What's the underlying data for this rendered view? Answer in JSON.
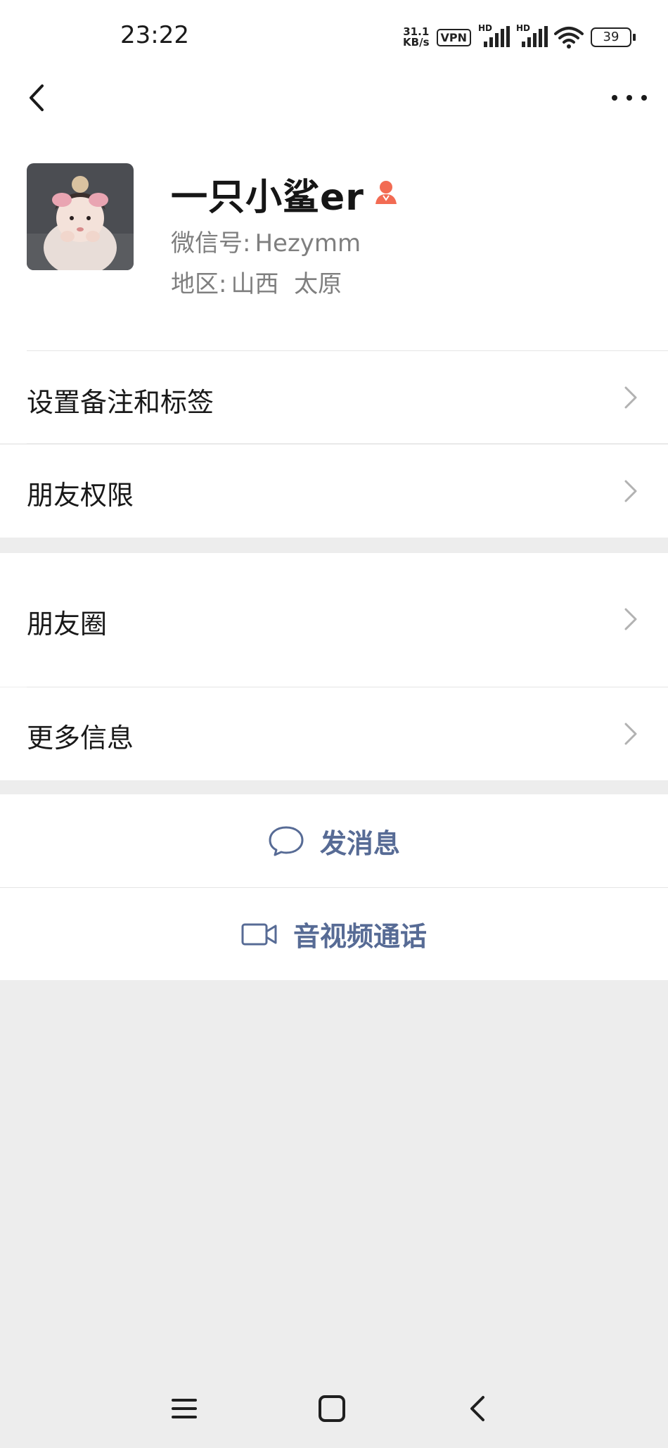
{
  "status_bar": {
    "time": "23:22",
    "net_speed_value": "31.1",
    "net_speed_unit": "KB/s",
    "vpn": "VPN",
    "signal_1_label": "HD",
    "signal_2_label": "HD",
    "battery": "39"
  },
  "nav": {
    "back_icon": "chevron-left-icon",
    "more_icon": "more-dots-icon"
  },
  "profile": {
    "nickname": "一只小鲨er",
    "gender_icon": "female-icon",
    "wechat_id_label": "微信号:",
    "wechat_id": "Hezymm",
    "region_label": "地区:",
    "region": "山西  太原"
  },
  "menu": {
    "set_remark_tags": "设置备注和标签",
    "friend_permissions": "朋友权限",
    "moments": "朋友圈",
    "more_info": "更多信息"
  },
  "actions": {
    "send_message": "发消息",
    "av_call": "音视频通话"
  },
  "colors": {
    "link_blue": "#576b95",
    "background": "#ededed",
    "gender_female": "#f26b53"
  }
}
